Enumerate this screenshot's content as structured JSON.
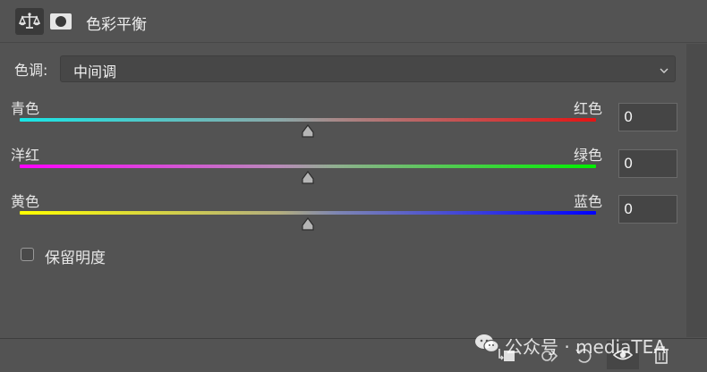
{
  "header": {
    "title": "色彩平衡",
    "icons": [
      "balance-scale-icon",
      "mask-icon"
    ]
  },
  "tone": {
    "label": "色调:",
    "value": "中间调"
  },
  "sliders": [
    {
      "left_label": "青色",
      "right_label": "红色",
      "value": "0",
      "level": 0.5
    },
    {
      "left_label": "洋红",
      "right_label": "绿色",
      "value": "0",
      "level": 0.5
    },
    {
      "left_label": "黄色",
      "right_label": "蓝色",
      "value": "0",
      "level": 0.5
    }
  ],
  "preserve_luminosity": {
    "label": "保留明度",
    "checked": false
  },
  "watermark": {
    "text": "公众号 · mediaTEA"
  },
  "footer": {
    "icons": [
      "clip-to-layer-icon",
      "view-previous-icon",
      "reset-icon",
      "visibility-eye-icon",
      "trash-icon"
    ]
  },
  "colors": {
    "panel_bg": "#535353",
    "cyan": "#18e6e6",
    "red": "#e51414",
    "magenta": "#ff00ff",
    "green": "#00f000",
    "yellow": "#ffff00",
    "blue": "#0000ff"
  }
}
